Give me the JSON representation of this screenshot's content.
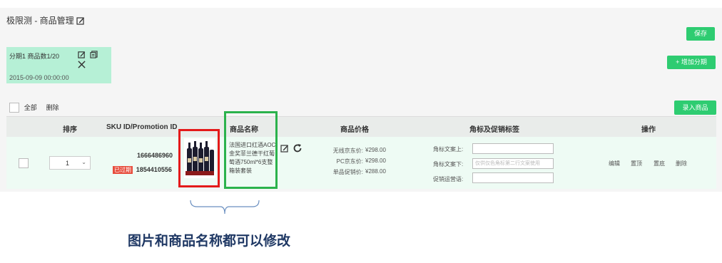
{
  "page": {
    "title": "极限测 - 商品管理"
  },
  "toolbar": {
    "save_label": "保存",
    "add_period_label": "+ 增加分期",
    "enter_product_label": "录入商品"
  },
  "period_card": {
    "header": "分期1 商品数1/20",
    "datetime": "2015-09-09 00:00:00"
  },
  "bulk": {
    "select_all": "全部",
    "delete": "删除"
  },
  "table": {
    "headers": {
      "order": "排序",
      "sku": "SKU ID/Promotion ID",
      "name": "商品名称",
      "price": "商品价格",
      "tags": "角标及促销标签",
      "ops": "操作"
    },
    "row": {
      "order_value": "1",
      "sku_id": "1666486960",
      "promotion_id": "1854410556",
      "status_badge": "已过期",
      "product_name": "法国进口红酒AOC金奖菲兰德干红葡萄酒750ml*6支整箱装套装",
      "prices": [
        {
          "label": "无线京东价:",
          "value": "¥298.00"
        },
        {
          "label": "PC京东价:",
          "value": "¥298.00"
        },
        {
          "label": "单品促销价:",
          "value": "¥288.00"
        }
      ],
      "tags": [
        {
          "label": "角标文案上:",
          "placeholder": ""
        },
        {
          "label": "角标文案下:",
          "placeholder": "仅供仅色角标第二行文案使用"
        },
        {
          "label": "促销运营语:",
          "placeholder": ""
        }
      ],
      "operations": [
        "编辑",
        "置顶",
        "置底",
        "删除"
      ]
    }
  },
  "annotation": {
    "caption": "图片和商品名称都可以修改",
    "red_box_color": "#e41a1a",
    "green_box_color": "#2bb24c"
  }
}
